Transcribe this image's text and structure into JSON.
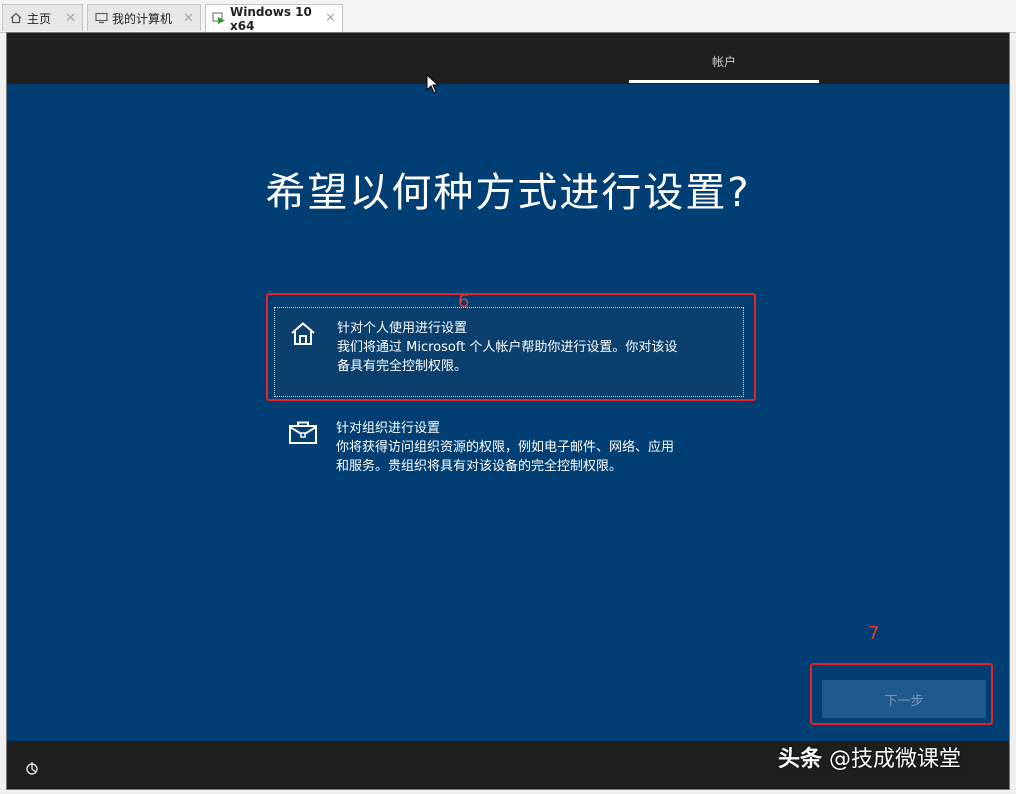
{
  "tabs": [
    {
      "label": "主页",
      "icon": "home-icon"
    },
    {
      "label": "我的计算机",
      "icon": "computer-icon"
    },
    {
      "label": "Windows 10 x64",
      "icon": "vm-icon"
    }
  ],
  "progress": {
    "step_label": "帐户"
  },
  "heading": "希望以何种方式进行设置?",
  "annotations": {
    "step6": "6",
    "step7": "7"
  },
  "options": [
    {
      "title": "针对个人使用进行设置",
      "desc_line1": "我们将通过 Microsoft 个人帐户帮助你进行设置。你对该设",
      "desc_line2": "备具有完全控制权限。",
      "icon": "home-icon",
      "selected": true
    },
    {
      "title": "针对组织进行设置",
      "desc_line1": "你将获得访问组织资源的权限，例如电子邮件、网络、应用",
      "desc_line2": "和服务。贵组织将具有对该设备的完全控制权限。",
      "icon": "briefcase-icon",
      "selected": false
    }
  ],
  "next_button": "下一步",
  "watermark": {
    "brand": "头条",
    "handle": "@技成微课堂"
  },
  "colors": {
    "oobe_bg": "#003e74",
    "annotation": "#e52424"
  }
}
